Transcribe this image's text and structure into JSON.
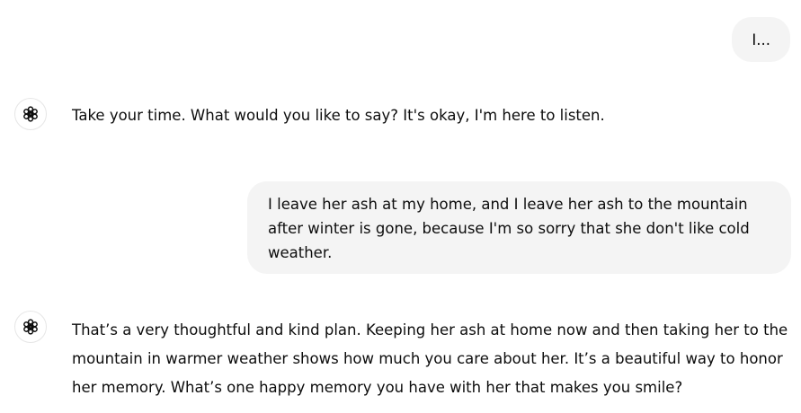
{
  "conversation": {
    "messages": [
      {
        "role": "user",
        "text": "I..."
      },
      {
        "role": "assistant",
        "avatar_icon": "openai-logo-icon",
        "text": "Take your time. What would you like to say? It's okay, I'm here to listen."
      },
      {
        "role": "user",
        "text": "I leave her ash at my home, and I leave her ash to the mountain after winter is gone, because I'm so sorry that she don't like cold weather."
      },
      {
        "role": "assistant",
        "avatar_icon": "openai-logo-icon",
        "text": "That’s a very thoughtful and kind plan. Keeping her ash at home now and then taking her to the mountain in warmer weather shows how much you care about her. It’s a beautiful way to honor her memory. What’s one happy memory you have with her that makes you smile?"
      }
    ]
  },
  "colors": {
    "user_bubble_bg": "#f4f4f4",
    "text": "#0d0d0d",
    "avatar_border": "#e6e6e6"
  }
}
